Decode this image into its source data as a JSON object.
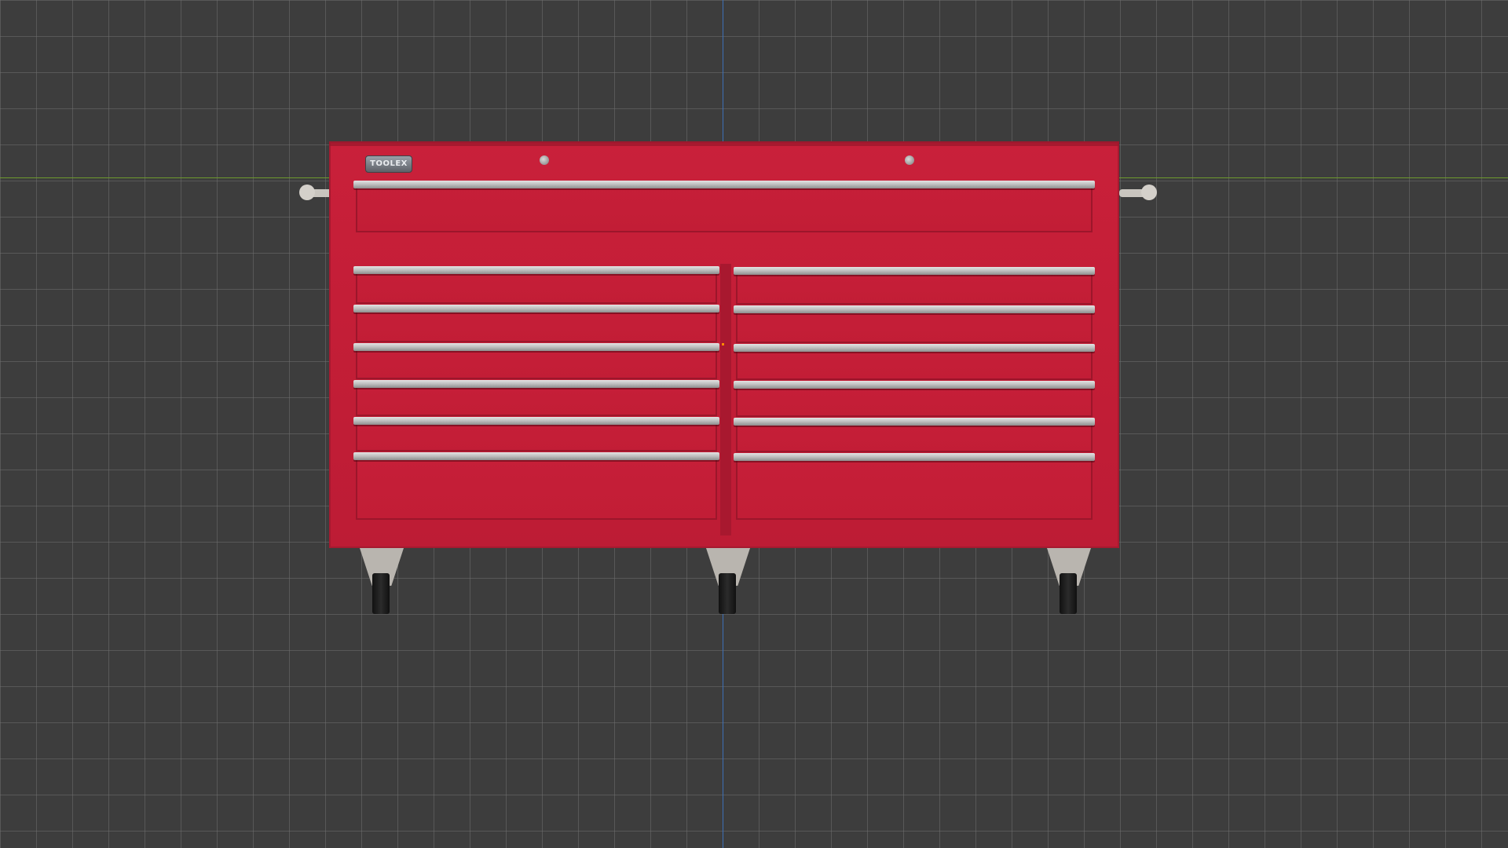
{
  "scene": {
    "background_color": "#3d3d3d",
    "grid_color": "#6e6e6e",
    "x_axis_color": "#6e9a2e",
    "y_axis_color": "#3d6fb5"
  },
  "tool_chest": {
    "brand_text": "TOOLEX",
    "body_color": "#c41e37",
    "handle_color": "#cfcfcf",
    "drawers": {
      "top_full_width": 1,
      "left_column": 6,
      "right_column": 6
    },
    "badge_text": "",
    "casters": 3
  }
}
